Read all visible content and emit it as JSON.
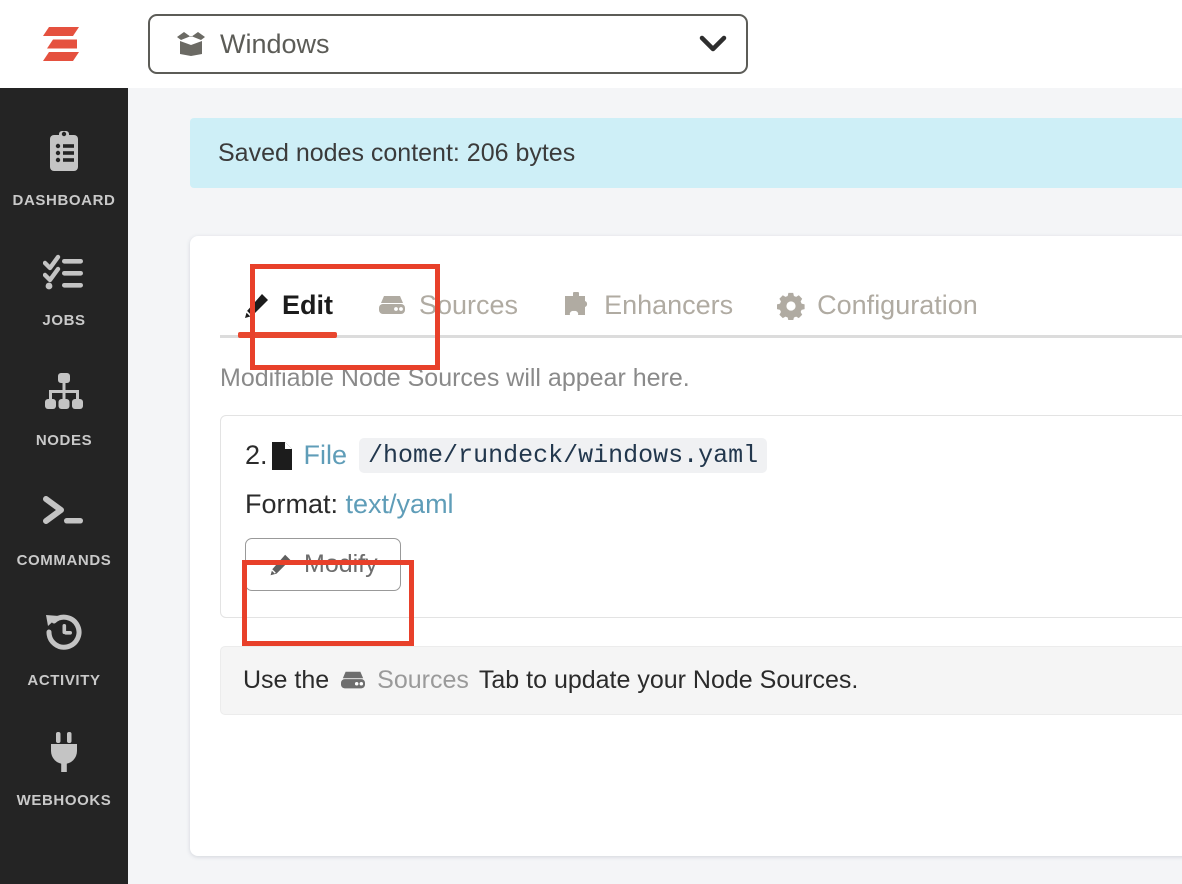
{
  "header": {
    "logo_name": "rundeck-logo",
    "project_selector": {
      "icon": "open-box-icon",
      "label": "Windows",
      "chevron": "chevron-down-icon"
    }
  },
  "sidebar": {
    "items": [
      {
        "label": "DASHBOARD",
        "icon": "clipboard-list-icon"
      },
      {
        "label": "JOBS",
        "icon": "checklist-icon"
      },
      {
        "label": "NODES",
        "icon": "sitemap-icon"
      },
      {
        "label": "COMMANDS",
        "icon": "terminal-icon"
      },
      {
        "label": "ACTIVITY",
        "icon": "history-clock-icon"
      },
      {
        "label": "WEBHOOKS",
        "icon": "plug-icon"
      }
    ]
  },
  "main": {
    "alert": {
      "text": "Saved nodes content: 206 bytes"
    },
    "tabs": [
      {
        "label": "Edit",
        "icon": "pencil-icon",
        "active": true
      },
      {
        "label": "Sources",
        "icon": "hdd-icon",
        "active": false
      },
      {
        "label": "Enhancers",
        "icon": "puzzle-piece-icon",
        "active": false
      },
      {
        "label": "Configuration",
        "icon": "gear-icon",
        "active": false
      }
    ],
    "hint": "Modifiable Node Sources will appear here.",
    "source": {
      "index": "2.",
      "file_icon": "file-icon",
      "type_label": "File",
      "path": "/home/rundeck/windows.yaml",
      "format_label": "Format:",
      "format_value": "text/yaml",
      "modify_button": {
        "label": "Modify",
        "icon": "pencil-icon"
      }
    },
    "note": {
      "prefix": "Use the",
      "icon": "hdd-icon",
      "link": "Sources",
      "suffix": "Tab to update your Node Sources."
    }
  },
  "colors": {
    "brand_red": "#e8472f",
    "annotation_red": "#e8402a",
    "alert_bg": "#ceeff7",
    "link_teal": "#5f9db8",
    "sidebar_bg": "#242424",
    "page_bg": "#f4f5f7"
  }
}
